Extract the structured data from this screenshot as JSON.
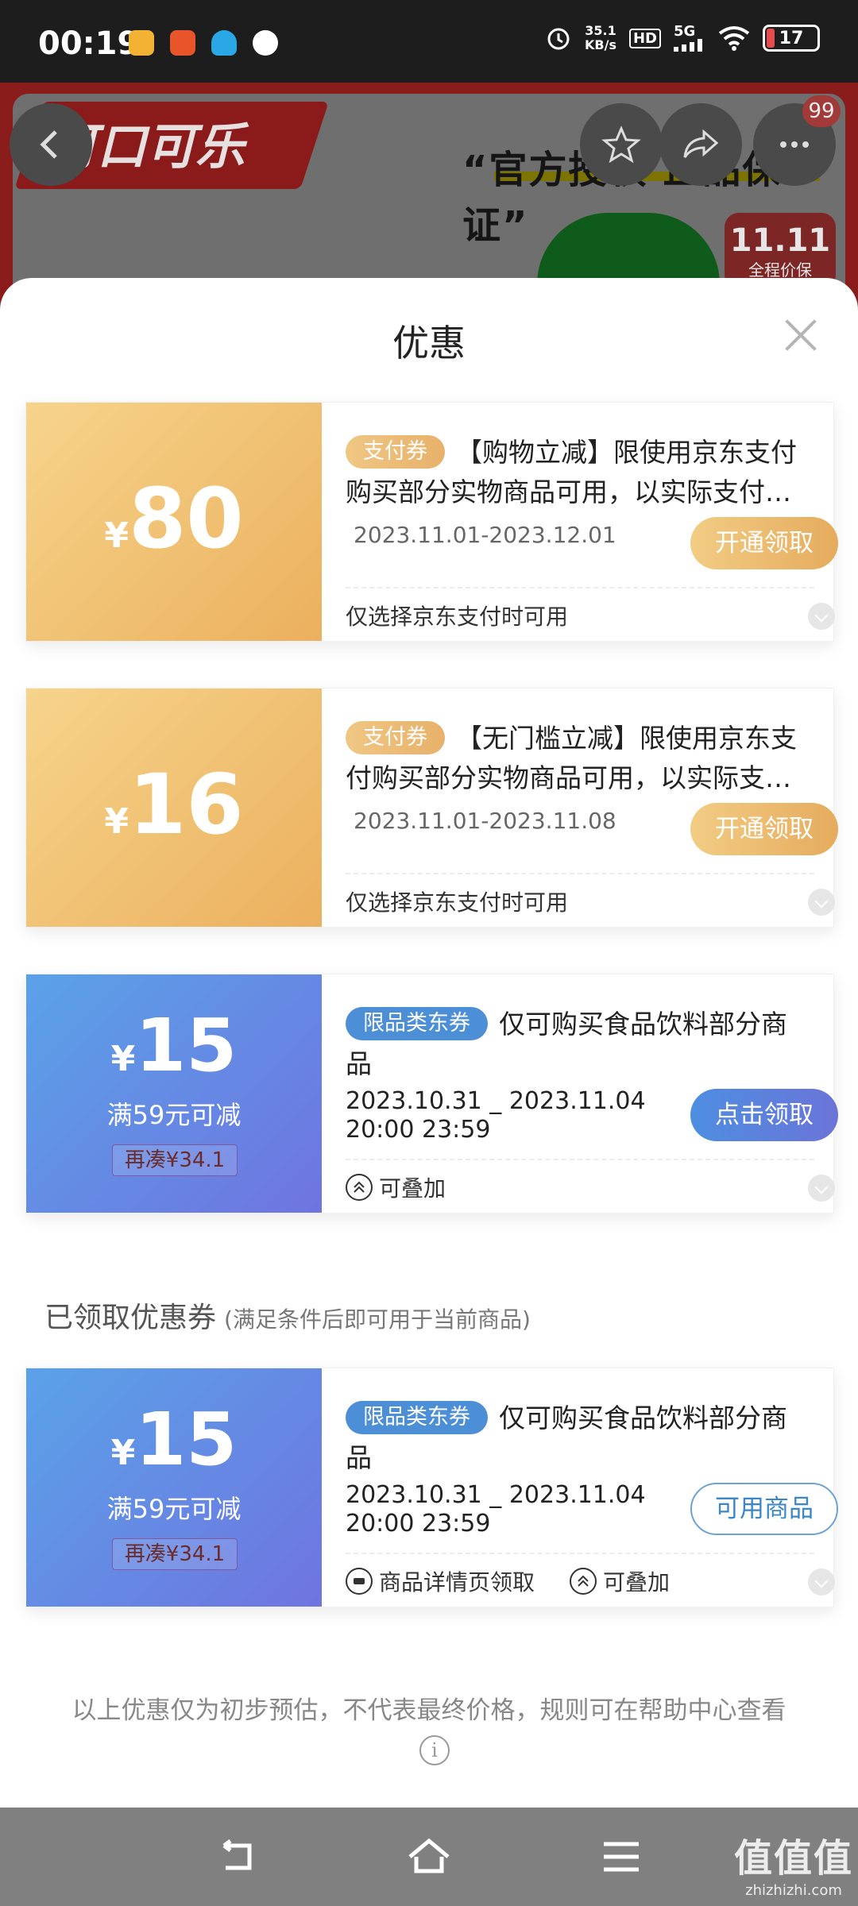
{
  "status_bar": {
    "time": "00:19",
    "net_speed_value": "35.1",
    "net_speed_unit": "KB/s",
    "hd": "HD",
    "signal": "5G",
    "battery": "17",
    "icons": [
      "notification-app-icon",
      "notification-app-icon-2",
      "qq-icon",
      "message-icon",
      "alarm-icon",
      "signal-icon",
      "wifi-icon",
      "battery-icon"
    ]
  },
  "product": {
    "brand_logo": "可口可乐",
    "slogan": "“官方授权 正品保证”",
    "badge_line1": "11.11",
    "badge_line2": "全程价保",
    "more_count": "99"
  },
  "sheet": {
    "title": "优惠",
    "coupons": [
      {
        "currency": "¥",
        "amount": "80",
        "tag": "支付券",
        "description": "【购物立减】限使用京东支付购买部分实物商品可用，以实际支付页面展示为准",
        "dates": "2023.11.01-2023.12.01",
        "action": "开通领取",
        "footnote": "仅选择京东支付时可用"
      },
      {
        "currency": "¥",
        "amount": "16",
        "tag": "支付券",
        "description": "【无门槛立减】限使用京东支付购买部分实物商品可用，以实际支付页面展示为准",
        "dates": "2023.11.01-2023.11.08",
        "action": "开通领取",
        "footnote": "仅选择京东支付时可用"
      },
      {
        "currency": "¥",
        "amount": "15",
        "condition": "满59元可减",
        "top_up": "再凑¥34.1",
        "tag": "限品类东券",
        "description": "仅可购买食品饮料部分商品",
        "dates_line1": "2023.10.31 _ 2023.11.04",
        "dates_line2": "20:00 23:59",
        "action": "点击领取",
        "footnote": "可叠加"
      }
    ],
    "claimed_title": "已领取优惠券",
    "claimed_subtitle": "(满足条件后即可用于当前商品)",
    "claimed_coupon": {
      "currency": "¥",
      "amount": "15",
      "condition": "满59元可减",
      "top_up": "再凑¥34.1",
      "tag": "限品类东券",
      "description": "仅可购买食品饮料部分商品",
      "dates_line1": "2023.10.31 _ 2023.11.04",
      "dates_line2": "20:00 23:59",
      "action": "可用商品",
      "footnote1": "商品详情页领取",
      "footnote2": "可叠加"
    },
    "disclaimer": "以上优惠仅为初步预估，不代表最终价格，规则可在帮助中心查看"
  },
  "watermark": {
    "line1": "值值值",
    "line2": "zhizhizhi.com"
  },
  "colors": {
    "gold_start": "#f7d48b",
    "gold_end": "#ebb05e",
    "blue_start": "#5aa2e8",
    "blue_end": "#6f74e0",
    "accent_blue": "#3a86c8"
  }
}
